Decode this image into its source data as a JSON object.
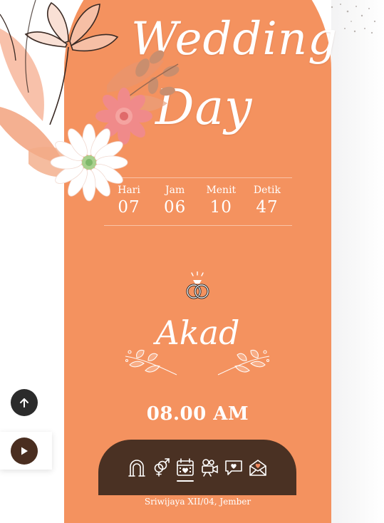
{
  "hero": {
    "title_line1": "Wedding",
    "title_line2": "Day"
  },
  "countdown": [
    {
      "label": "Hari",
      "value": "07"
    },
    {
      "label": "Jam",
      "value": "06"
    },
    {
      "label": "Menit",
      "value": "10"
    },
    {
      "label": "Detik",
      "value": "47"
    }
  ],
  "event": {
    "icon": "wedding-rings-icon",
    "title": "Akad",
    "time": "08.00 AM",
    "address": "Sriwijaya XII/04, Jember"
  },
  "nav": {
    "items": [
      {
        "icon": "arch-icon"
      },
      {
        "icon": "couple-gender-icon"
      },
      {
        "icon": "calendar-icon",
        "active": true
      },
      {
        "icon": "video-camera-icon"
      },
      {
        "icon": "chat-heart-icon"
      },
      {
        "icon": "envelope-heart-icon"
      }
    ]
  },
  "controls": {
    "scroll_top_icon": "arrow-up-icon",
    "music_icon": "play-icon"
  },
  "colors": {
    "card": "#f4925f",
    "nav_bg": "#4a3123",
    "text": "#ffffff",
    "dark_button": "#2b2b2b",
    "play_button": "#4a2e20"
  }
}
